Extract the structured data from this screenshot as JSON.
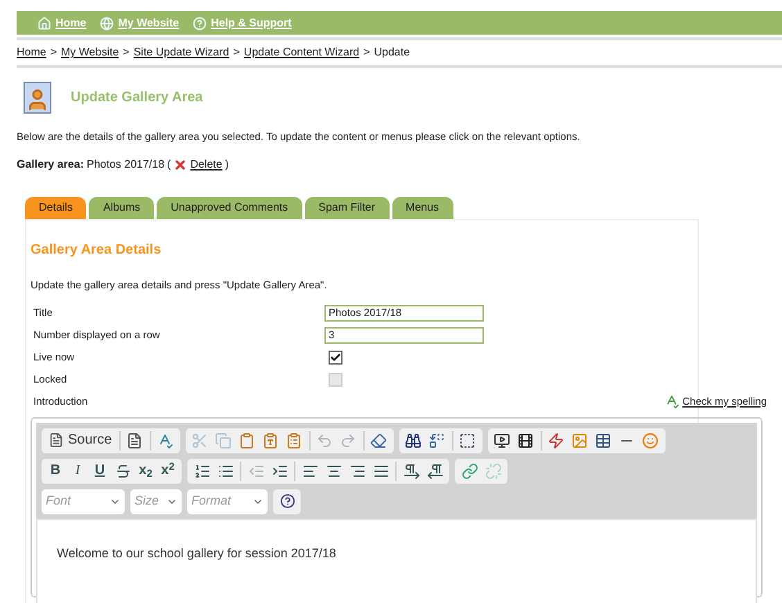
{
  "nav": [
    {
      "kind": "home",
      "label": "Home"
    },
    {
      "kind": "globe",
      "label": "My Website"
    },
    {
      "kind": "help",
      "label": "Help & Support"
    }
  ],
  "breadcrumb": {
    "links": [
      "Home",
      "My Website",
      "Site Update Wizard",
      "Update Content Wizard"
    ],
    "separator": ">",
    "current": "Update"
  },
  "page_title": "Update Gallery Area",
  "intro": "Below are the details of the gallery area you selected. To update the content or menus please click on the relevant options.",
  "gallery_area": {
    "label": "Gallery area:",
    "value": "Photos 2017/18",
    "open": "(",
    "delete": "Delete",
    "close": ")"
  },
  "tabs": [
    {
      "label": "Details",
      "selected": true
    },
    {
      "label": "Albums",
      "selected": false
    },
    {
      "label": "Unapproved Comments",
      "selected": false
    },
    {
      "label": "Spam Filter",
      "selected": false
    },
    {
      "label": "Menus",
      "selected": false
    }
  ],
  "section_title": "Gallery Area Details",
  "section_intro": "Update the gallery area details and press \"Update Gallery Area\".",
  "fields": [
    {
      "kind": "text",
      "label": "Title",
      "value": "Photos 2017/18"
    },
    {
      "kind": "text",
      "label": "Number displayed on a row",
      "value": "3"
    },
    {
      "kind": "checkbox",
      "label": "Live now",
      "checked": true,
      "disabled": false
    },
    {
      "kind": "checkbox",
      "label": "Locked",
      "checked": false,
      "disabled": true
    }
  ],
  "introduction_label": "Introduction",
  "spell_check": "Check my spelling",
  "editor": {
    "toolbar_rows": [
      [
        [
          {
            "kind": "source",
            "label": "Source",
            "disabled": false
          },
          {
            "kind": "sep"
          },
          {
            "kind": "templates",
            "disabled": false
          },
          {
            "kind": "sep"
          },
          {
            "kind": "spellcheck",
            "disabled": false
          }
        ],
        [
          {
            "kind": "cut",
            "disabled": true
          },
          {
            "kind": "copy",
            "disabled": true
          },
          {
            "kind": "paste",
            "disabled": false
          },
          {
            "kind": "paste-text",
            "disabled": false
          },
          {
            "kind": "paste-word",
            "disabled": false
          },
          {
            "kind": "sep"
          },
          {
            "kind": "undo",
            "disabled": true
          },
          {
            "kind": "redo",
            "disabled": true
          },
          {
            "kind": "sep"
          },
          {
            "kind": "eraser",
            "disabled": false
          }
        ],
        [
          {
            "kind": "find",
            "disabled": false
          },
          {
            "kind": "replace",
            "disabled": false
          },
          {
            "kind": "sep"
          },
          {
            "kind": "select-all",
            "disabled": false
          }
        ],
        [
          {
            "kind": "video",
            "disabled": false
          },
          {
            "kind": "film",
            "disabled": false
          },
          {
            "kind": "sep"
          },
          {
            "kind": "flash",
            "disabled": false
          },
          {
            "kind": "image",
            "disabled": false
          },
          {
            "kind": "table",
            "disabled": false
          },
          {
            "kind": "rule",
            "disabled": false
          },
          {
            "kind": "smiley",
            "disabled": false
          }
        ]
      ],
      [
        [
          {
            "kind": "bold",
            "label": "B",
            "disabled": false
          },
          {
            "kind": "italic",
            "label": "I",
            "disabled": false
          },
          {
            "kind": "underline",
            "label": "U",
            "disabled": false
          },
          {
            "kind": "strike",
            "disabled": false
          },
          {
            "kind": "subscript",
            "label": "x$_{2}$",
            "disabled": false
          },
          {
            "kind": "superscript",
            "label": "x$^{2}$",
            "disabled": false
          }
        ],
        [
          {
            "kind": "ol",
            "disabled": false
          },
          {
            "kind": "ul",
            "disabled": false
          },
          {
            "kind": "sep"
          },
          {
            "kind": "outdent",
            "disabled": true
          },
          {
            "kind": "indent",
            "disabled": false
          },
          {
            "kind": "sep"
          },
          {
            "kind": "align-left",
            "disabled": false
          },
          {
            "kind": "align-center",
            "disabled": false
          },
          {
            "kind": "align-right",
            "disabled": false
          },
          {
            "kind": "align-justify",
            "disabled": false
          },
          {
            "kind": "sep"
          },
          {
            "kind": "ltr",
            "disabled": false
          },
          {
            "kind": "rtl",
            "disabled": false
          }
        ],
        [
          {
            "kind": "link",
            "disabled": false
          },
          {
            "kind": "unlink",
            "disabled": true
          }
        ]
      ]
    ],
    "dropdowns": [
      {
        "placeholder": "Font"
      },
      {
        "placeholder": "Size"
      },
      {
        "placeholder": "Format"
      }
    ],
    "content": "Welcome to our school gallery for session 2017/18"
  }
}
